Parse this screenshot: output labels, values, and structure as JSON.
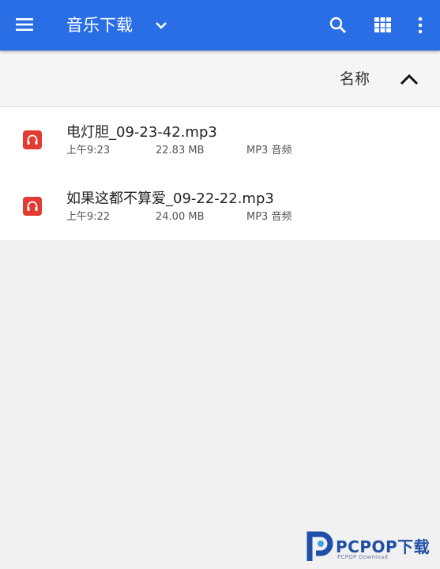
{
  "header": {
    "title": "音乐下载",
    "icons": [
      "menu-icon",
      "chevron-down-icon",
      "search-icon",
      "grid-view-icon",
      "more-vert-icon"
    ],
    "bar_color": "#2a6ee6"
  },
  "sort": {
    "label": "名称",
    "direction_icon": "chevron-up-icon"
  },
  "files": [
    {
      "name": "电灯胆_09-23-42.mp3",
      "time": "上午9:23",
      "size": "22.83 MB",
      "type": "MP3 音频",
      "icon": "headphones-icon"
    },
    {
      "name": "如果这都不算爱_09-22-22.mp3",
      "time": "上午9:22",
      "size": "24.00 MB",
      "type": "MP3 音频",
      "icon": "headphones-icon"
    }
  ],
  "watermark": {
    "brand": "PCPOP下载",
    "sub": "PCPOP Download"
  },
  "colors": {
    "file_icon": "#e23b32",
    "accent": "#2a6ee6"
  }
}
